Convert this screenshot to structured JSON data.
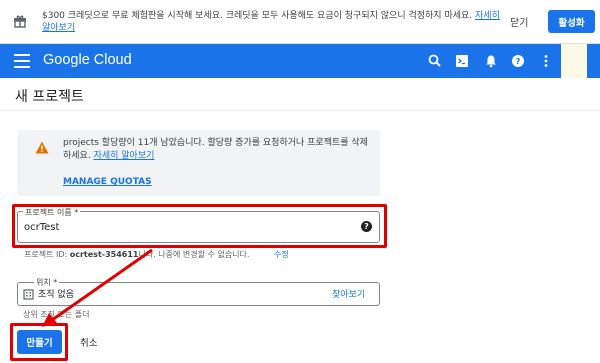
{
  "promo": {
    "text": "$300 크레딧으로 무료 체험판을 시작해 보세요. 크레딧을 모두 사용해도 요금이 청구되지 않으니 걱정하지 마세요.",
    "link": "자세히 알아보기",
    "close_label": "닫기",
    "activate_label": "활성화",
    "icon": "gift-icon"
  },
  "header": {
    "brand": "Google Cloud",
    "icons": [
      "search-icon",
      "terminal-icon",
      "bell-icon",
      "help-icon",
      "more-vert-icon"
    ]
  },
  "page": {
    "title": "새 프로젝트"
  },
  "notice": {
    "text": "projects 할당량이 11개 남았습니다. 할당량 증가를 요청하거나 프로젝트를 삭제하세요.",
    "link": "자세히 알아보기",
    "manage_label": "MANAGE QUOTAS",
    "icon": "warning-icon"
  },
  "project_name": {
    "label": "프로젝트 이름 *",
    "value": "ocrTest"
  },
  "project_id": {
    "prefix": "프로젝트 ID: ",
    "id": "ocrtest-354611",
    "suffix": "니다. 나중에 변경할 수 없습니다.",
    "edit_label": "수정"
  },
  "location": {
    "label": "위치 *",
    "value": "조직 없음",
    "browse_label": "찾아보기",
    "help": "상위 조직 또는 폴더"
  },
  "actions": {
    "create_label": "만들기",
    "cancel_label": "취소"
  },
  "colors": {
    "primary": "#1a73e8",
    "annotation": "#e00000",
    "warning": "#e37400"
  }
}
